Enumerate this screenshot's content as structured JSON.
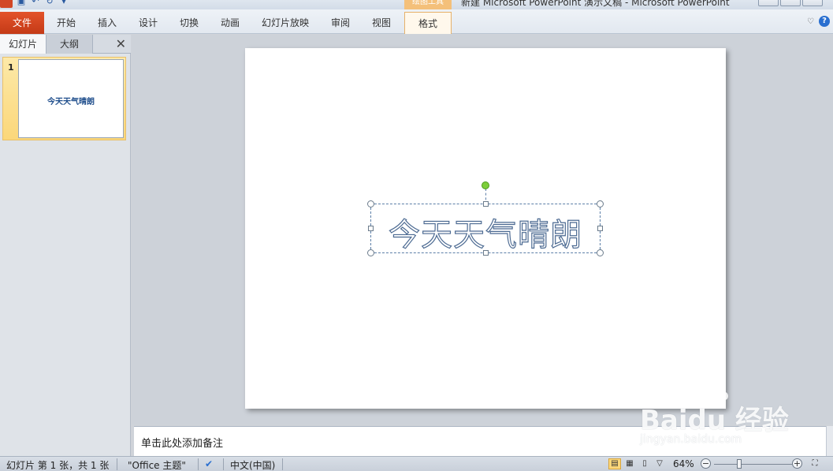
{
  "window": {
    "title": "新建 Microsoft PowerPoint 演示文稿 - Microsoft PowerPoint",
    "context_tab_group": "绘图工具"
  },
  "ribbon": {
    "file_tab": "文件",
    "tabs": [
      "开始",
      "插入",
      "设计",
      "切换",
      "动画",
      "幻灯片放映",
      "审阅",
      "视图"
    ],
    "context_tab": "格式"
  },
  "left_pane": {
    "tabs": [
      "幻灯片",
      "大纲"
    ],
    "close_glyph": "✕",
    "slides": [
      {
        "number": "1",
        "text": "今天天气晴朗"
      }
    ]
  },
  "slide": {
    "textbox_text": "今天天气晴朗"
  },
  "notes": {
    "placeholder": "单击此处添加备注"
  },
  "watermark": {
    "brand": "Baidu 经验",
    "url": "jingyan.baidu.com"
  },
  "statusbar": {
    "slide_info": "幻灯片 第 1 张，共 1 张",
    "theme": "\"Office 主题\"",
    "language": "中文(中国)",
    "zoom": "64%",
    "zoom_fraction": 0.64
  }
}
